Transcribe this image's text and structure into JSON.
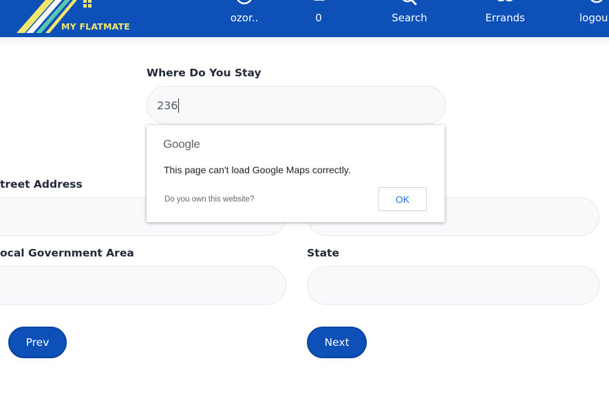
{
  "brand": {
    "name": "MY FLATMATE"
  },
  "nav": {
    "profile": "ozor..",
    "messages": "0",
    "search": "Search",
    "errands": "Errands",
    "logout": "logou"
  },
  "form": {
    "where_label": "Where Do You Stay",
    "where_value": "236",
    "street_label": "treet Address",
    "lga_label": "ocal Government Area",
    "state_label": "State",
    "prev": "Prev",
    "next": "Next"
  },
  "gmaps_dialog": {
    "logo": "Google",
    "message": "This page can't load Google Maps correctly.",
    "own_question": "Do you own this website?",
    "ok": "OK"
  },
  "colors": {
    "brand_blue": "#0d51b8",
    "logo_yellow": "#f4e66a",
    "google_blue": "#1a73e8"
  }
}
